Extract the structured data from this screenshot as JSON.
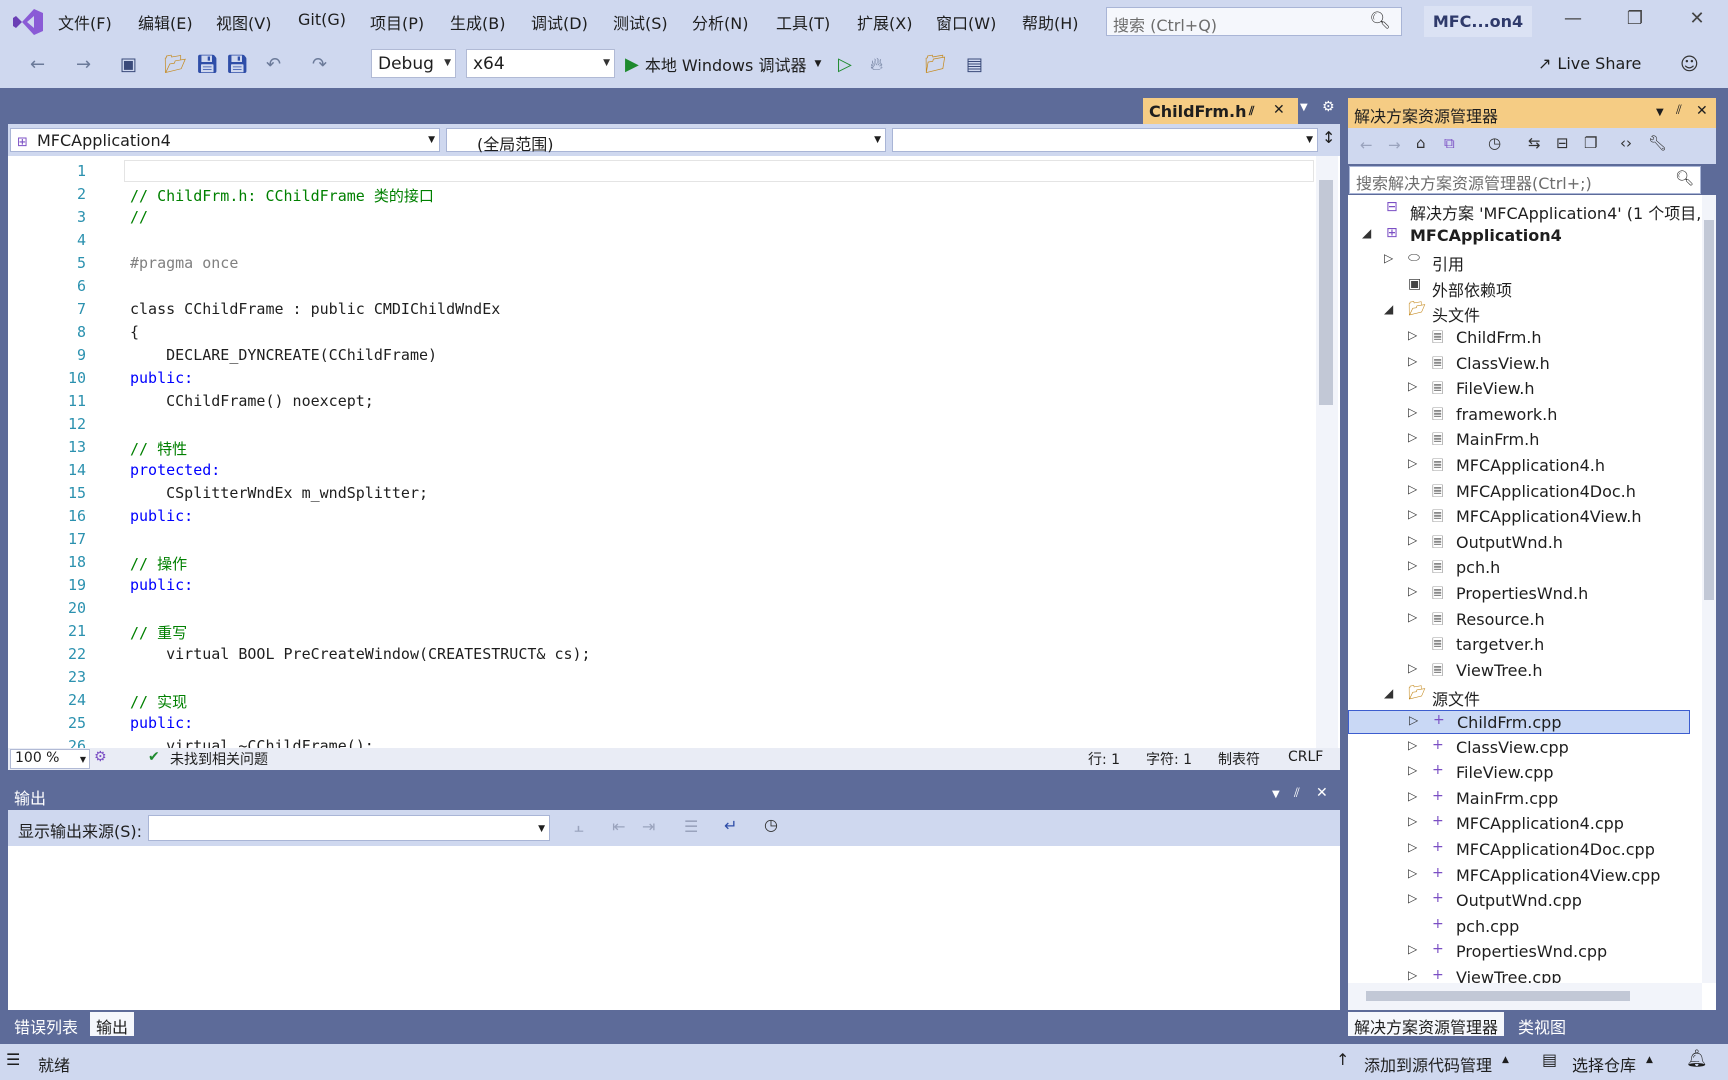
{
  "menu": [
    "文件(F)",
    "编辑(E)",
    "视图(V)",
    "Git(G)",
    "项目(P)",
    "生成(B)",
    "调试(D)",
    "测试(S)",
    "分析(N)",
    "工具(T)",
    "扩展(X)",
    "窗口(W)",
    "帮助(H)"
  ],
  "search": {
    "placeholder": "搜索 (Ctrl+Q)"
  },
  "window_title": "MFC...on4",
  "toolbar": {
    "config": "Debug",
    "platform": "x64",
    "run_label": "本地 Windows 调试器",
    "live_share": "Live Share"
  },
  "editor": {
    "tab": "ChildFrm.h",
    "nav_project": "MFCApplication4",
    "nav_scope": "(全局范围)",
    "lines": [
      {
        "n": "1",
        "t": ""
      },
      {
        "n": "2",
        "t": "// ChildFrm.h: CChildFrame 类的接口",
        "k": "cm"
      },
      {
        "n": "3",
        "t": "//",
        "k": "cm"
      },
      {
        "n": "4",
        "t": ""
      },
      {
        "n": "5",
        "t": "#pragma once",
        "k": "pp"
      },
      {
        "n": "6",
        "t": ""
      },
      {
        "n": "7",
        "t": "class CChildFrame : public CMDIChildWndEx",
        "k": "class"
      },
      {
        "n": "8",
        "t": "{"
      },
      {
        "n": "9",
        "t": "    DECLARE_DYNCREATE(CChildFrame)"
      },
      {
        "n": "10",
        "t": "public:",
        "k": "kw"
      },
      {
        "n": "11",
        "t": "    CChildFrame() noexcept;",
        "k": "noexcept"
      },
      {
        "n": "12",
        "t": ""
      },
      {
        "n": "13",
        "t": "// 特性",
        "k": "cm"
      },
      {
        "n": "14",
        "t": "protected:",
        "k": "kw"
      },
      {
        "n": "15",
        "t": "    CSplitterWndEx m_wndSplitter;"
      },
      {
        "n": "16",
        "t": "public:",
        "k": "kw"
      },
      {
        "n": "17",
        "t": ""
      },
      {
        "n": "18",
        "t": "// 操作",
        "k": "cm"
      },
      {
        "n": "19",
        "t": "public:",
        "k": "kw"
      },
      {
        "n": "20",
        "t": ""
      },
      {
        "n": "21",
        "t": "// 重写",
        "k": "cm"
      },
      {
        "n": "22",
        "t": "    virtual BOOL PreCreateWindow(CREATESTRUCT& cs);",
        "k": "virtual"
      },
      {
        "n": "23",
        "t": ""
      },
      {
        "n": "24",
        "t": "// 实现",
        "k": "cm"
      },
      {
        "n": "25",
        "t": "public:",
        "k": "kw"
      },
      {
        "n": "26",
        "t": "    virtual ~CChildFrame();",
        "k": "virtual"
      }
    ],
    "zoom": "100 %",
    "issues": "未找到相关问题",
    "line": "行: 1",
    "col": "字符: 1",
    "tabs_mode": "制表符",
    "eol": "CRLF"
  },
  "output": {
    "title": "输出",
    "source_label": "显示输出来源(S):",
    "tabs": [
      "错误列表",
      "输出"
    ]
  },
  "solution_explorer": {
    "title": "解决方案资源管理器",
    "search_placeholder": "搜索解决方案资源管理器(Ctrl+;)",
    "solution": "解决方案 'MFCApplication4' (1 个项目,",
    "project": "MFCApplication4",
    "references": "引用",
    "external": "外部依赖项",
    "headers_folder": "头文件",
    "headers": [
      "ChildFrm.h",
      "ClassView.h",
      "FileView.h",
      "framework.h",
      "MainFrm.h",
      "MFCApplication4.h",
      "MFCApplication4Doc.h",
      "MFCApplication4View.h",
      "OutputWnd.h",
      "pch.h",
      "PropertiesWnd.h",
      "Resource.h",
      "targetver.h",
      "ViewTree.h"
    ],
    "sources_folder": "源文件",
    "sources": [
      "ChildFrm.cpp",
      "ClassView.cpp",
      "FileView.cpp",
      "MainFrm.cpp",
      "MFCApplication4.cpp",
      "MFCApplication4Doc.cpp",
      "MFCApplication4View.cpp",
      "OutputWnd.cpp",
      "pch.cpp",
      "PropertiesWnd.cpp",
      "ViewTree.cpp"
    ],
    "tabs": [
      "解决方案资源管理器",
      "类视图"
    ]
  },
  "status": {
    "ready": "就绪",
    "add_source": "添加到源代码管理",
    "select_repo": "选择仓库"
  },
  "colors": {
    "accent": "#5d6b99",
    "chrome": "#cfd8ef",
    "active_tab": "#f5cc84",
    "vs_logo": "#7b4fc4"
  }
}
